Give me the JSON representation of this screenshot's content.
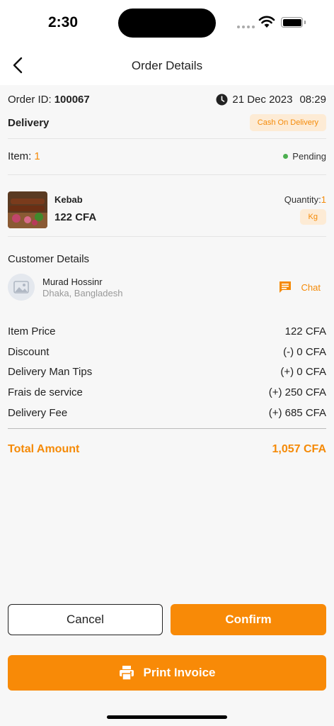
{
  "status_bar": {
    "time": "2:30"
  },
  "header": {
    "title": "Order Details"
  },
  "order": {
    "id_label": "Order ID:",
    "id": "100067",
    "date": "21 Dec 2023",
    "time": "08:29",
    "delivery_type": "Delivery",
    "payment_badge": "Cash On Delivery"
  },
  "items_summary": {
    "label": "Item:",
    "count": "1",
    "status": "Pending"
  },
  "product": {
    "name": "Kebab",
    "price": "122 CFA",
    "quantity_label": "Quantity:",
    "quantity": "1",
    "unit": "Kg"
  },
  "customer": {
    "section_title": "Customer Details",
    "name": "Murad Hossinr",
    "address": "Dhaka, Bangladesh",
    "chat_label": "Chat"
  },
  "pricing": [
    {
      "label": "Item Price",
      "value": "122 CFA"
    },
    {
      "label": "Discount",
      "value": "(-) 0 CFA"
    },
    {
      "label": "Delivery Man Tips",
      "value": "(+) 0 CFA"
    },
    {
      "label": "Frais de service",
      "value": "(+) 250 CFA"
    },
    {
      "label": "Delivery Fee",
      "value": "(+) 685 CFA"
    }
  ],
  "total": {
    "label": "Total Amount",
    "value": "1,057 CFA"
  },
  "actions": {
    "cancel": "Cancel",
    "confirm": "Confirm",
    "print": "Print Invoice"
  },
  "colors": {
    "accent": "#f88a07",
    "badge_bg": "#fdebd5",
    "status_green": "#4caf50"
  }
}
